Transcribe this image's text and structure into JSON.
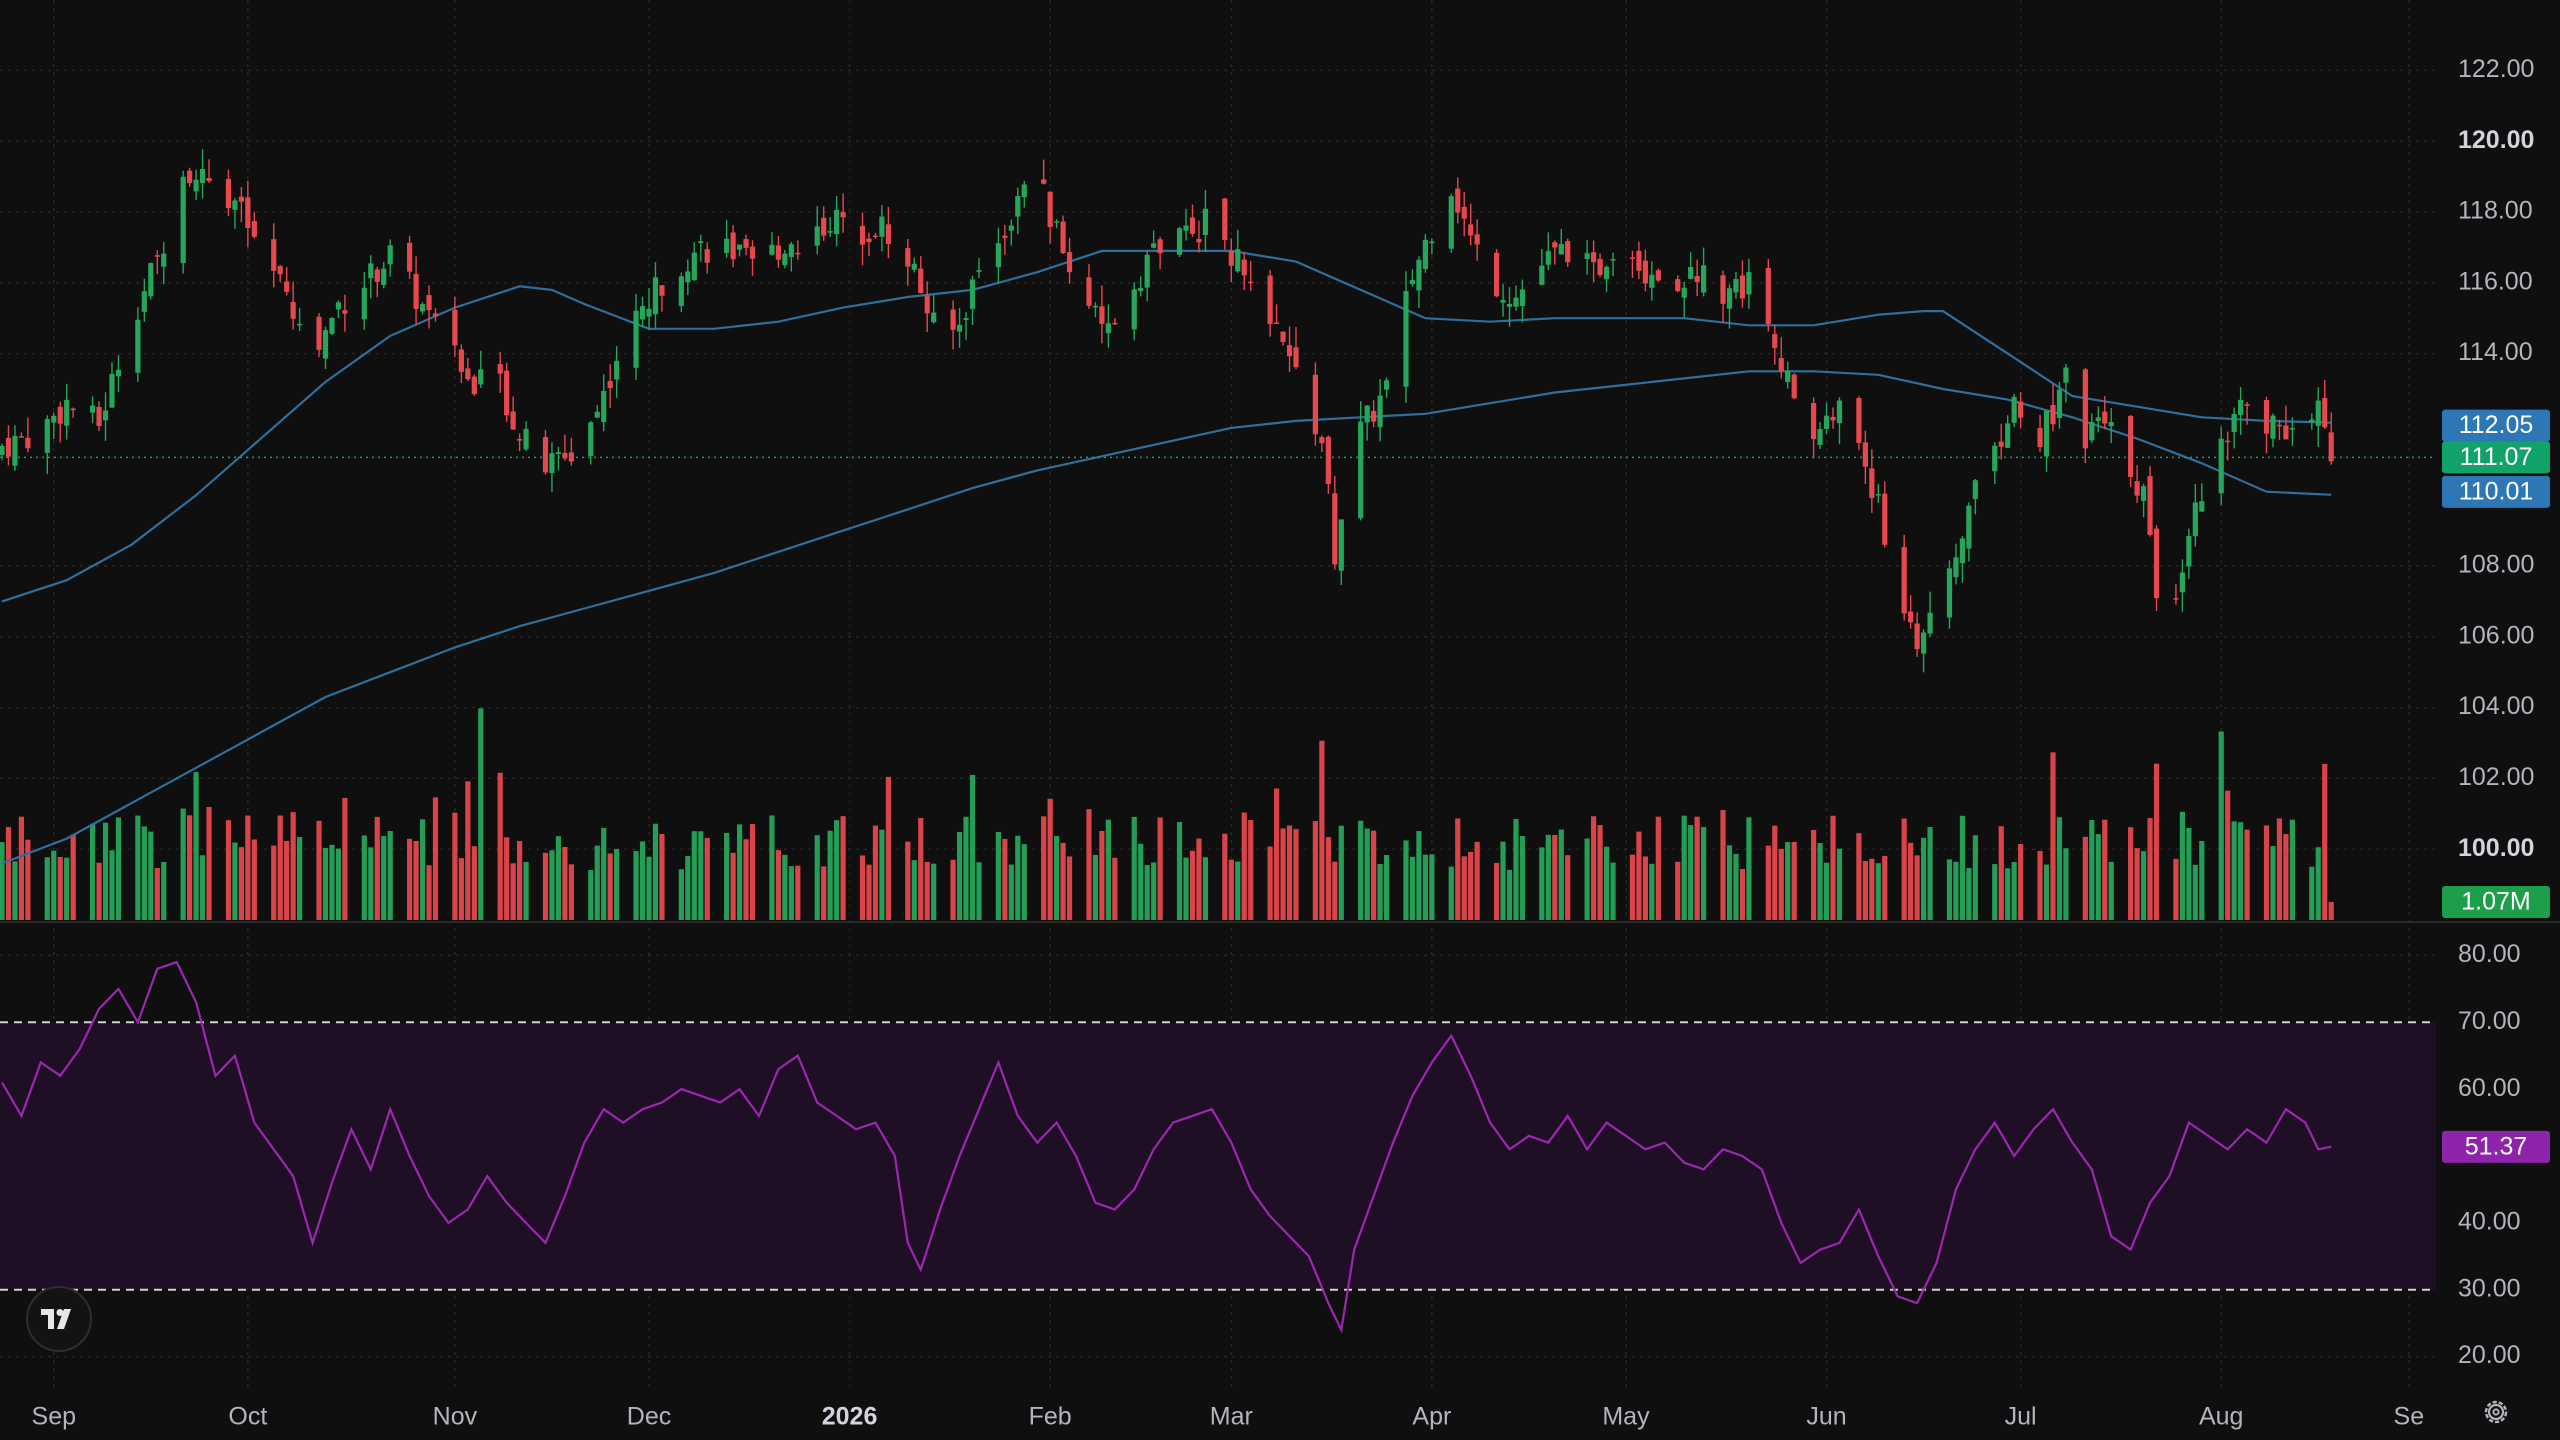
{
  "chart_data": {
    "type": "candlestick",
    "colors": {
      "background": "#0f0f0f",
      "grid": "#262626",
      "up": "#26a65b",
      "down": "#e5484d",
      "ma": "#2f6f9e",
      "rsi_line": "#9c27b0",
      "rsi_band": "#1e0f24",
      "axis_text": "#b2b5be",
      "badge_ma_fast": "#2d77b5",
      "badge_last": "#12a36a",
      "badge_volume": "#1d9e4a",
      "badge_rsi": "#8e24aa"
    },
    "price_axis": {
      "ylim": [
        98,
        123
      ],
      "ticks": [
        "122.00",
        "120.00",
        "118.00",
        "116.00",
        "114.00",
        "104.00",
        "102.00",
        "100.00"
      ],
      "bold_ticks": [
        "120.00",
        "100.00"
      ]
    },
    "rsi_axis": {
      "ylim": [
        15,
        85
      ],
      "ticks": [
        "80.00",
        "70.00",
        "60.00",
        "40.00",
        "30.00",
        "20.00"
      ],
      "upper_band": 70,
      "lower_band": 30
    },
    "time_axis": {
      "labels": [
        "Sep",
        "Oct",
        "Nov",
        "Dec",
        "2026",
        "Feb",
        "Mar",
        "Apr",
        "May",
        "Jun",
        "Jul",
        "Aug",
        "Se"
      ],
      "label_days": [
        8,
        38,
        70,
        100,
        131,
        162,
        190,
        221,
        251,
        282,
        312,
        343,
        372
      ],
      "bold_labels": [
        "2026"
      ]
    },
    "price_anchors": [
      [
        0,
        111.4
      ],
      [
        6,
        111.8
      ],
      [
        10,
        112.6
      ],
      [
        15,
        112.0
      ],
      [
        20,
        115.0
      ],
      [
        24,
        116.6
      ],
      [
        28,
        119.0
      ],
      [
        33,
        119.0
      ],
      [
        36,
        118.3
      ],
      [
        40,
        116.8
      ],
      [
        44,
        115.6
      ],
      [
        48,
        113.8
      ],
      [
        52,
        115.4
      ],
      [
        56,
        116.0
      ],
      [
        60,
        116.8
      ],
      [
        64,
        115.6
      ],
      [
        68,
        114.4
      ],
      [
        72,
        113.2
      ],
      [
        76,
        113.6
      ],
      [
        80,
        111.7
      ],
      [
        84,
        110.8
      ],
      [
        88,
        111.2
      ],
      [
        92,
        112.4
      ],
      [
        96,
        114.4
      ],
      [
        100,
        115.5
      ],
      [
        104,
        116.5
      ],
      [
        108,
        117.0
      ],
      [
        112,
        117.0
      ],
      [
        116,
        116.4
      ],
      [
        120,
        117.0
      ],
      [
        124,
        117.2
      ],
      [
        128,
        117.8
      ],
      [
        132,
        117.5
      ],
      [
        136,
        117.6
      ],
      [
        140,
        116.8
      ],
      [
        142,
        115.8
      ],
      [
        145,
        114.2
      ],
      [
        148,
        114.8
      ],
      [
        151,
        116.5
      ],
      [
        154,
        117.3
      ],
      [
        157,
        118.2
      ],
      [
        159,
        119.8
      ],
      [
        161,
        118.4
      ],
      [
        164,
        116.8
      ],
      [
        167,
        116.0
      ],
      [
        170,
        114.4
      ],
      [
        174,
        115.6
      ],
      [
        178,
        117.0
      ],
      [
        182,
        117.2
      ],
      [
        186,
        117.7
      ],
      [
        189,
        117.2
      ],
      [
        192,
        116.2
      ],
      [
        196,
        114.8
      ],
      [
        200,
        113.4
      ],
      [
        204,
        111.5
      ],
      [
        206,
        108.4
      ],
      [
        208,
        110.6
      ],
      [
        210,
        111.8
      ],
      [
        214,
        113.0
      ],
      [
        218,
        116.2
      ],
      [
        221,
        117.6
      ],
      [
        224,
        118.8
      ],
      [
        227,
        117.2
      ],
      [
        231,
        116.0
      ],
      [
        234,
        115.6
      ],
      [
        238,
        116.5
      ],
      [
        242,
        117.0
      ],
      [
        246,
        116.2
      ],
      [
        250,
        117.4
      ],
      [
        254,
        116.4
      ],
      [
        258,
        116.0
      ],
      [
        262,
        116.3
      ],
      [
        266,
        115.8
      ],
      [
        270,
        116.0
      ],
      [
        274,
        114.6
      ],
      [
        277,
        112.4
      ],
      [
        280,
        111.8
      ],
      [
        284,
        112.4
      ],
      [
        287,
        111.6
      ],
      [
        290,
        109.6
      ],
      [
        293,
        107.2
      ],
      [
        296,
        106.0
      ],
      [
        299,
        106.4
      ],
      [
        302,
        108.2
      ],
      [
        305,
        110.4
      ],
      [
        308,
        111.3
      ],
      [
        311,
        112.5
      ],
      [
        314,
        111.2
      ],
      [
        317,
        112.4
      ],
      [
        319,
        113.6
      ],
      [
        322,
        111.6
      ],
      [
        325,
        112.0
      ],
      [
        328,
        111.2
      ],
      [
        331,
        110.0
      ],
      [
        334,
        106.0
      ],
      [
        337,
        108.2
      ],
      [
        340,
        110.2
      ],
      [
        343,
        111.4
      ],
      [
        346,
        112.5
      ],
      [
        349,
        111.6
      ],
      [
        352,
        112.2
      ],
      [
        355,
        111.4
      ],
      [
        358,
        112.5
      ],
      [
        360,
        111.07
      ]
    ],
    "last_day": 360,
    "moving_averages": [
      {
        "period": 50,
        "points": [
          [
            0,
            107.0
          ],
          [
            10,
            107.6
          ],
          [
            20,
            108.6
          ],
          [
            30,
            110.0
          ],
          [
            40,
            111.6
          ],
          [
            50,
            113.2
          ],
          [
            60,
            114.5
          ],
          [
            70,
            115.3
          ],
          [
            80,
            115.9
          ],
          [
            85,
            115.8
          ],
          [
            90,
            115.4
          ],
          [
            100,
            114.7
          ],
          [
            110,
            114.7
          ],
          [
            120,
            114.9
          ],
          [
            130,
            115.3
          ],
          [
            140,
            115.6
          ],
          [
            150,
            115.8
          ],
          [
            160,
            116.3
          ],
          [
            170,
            116.9
          ],
          [
            180,
            116.9
          ],
          [
            190,
            116.9
          ],
          [
            200,
            116.6
          ],
          [
            210,
            115.8
          ],
          [
            220,
            115.0
          ],
          [
            230,
            114.9
          ],
          [
            240,
            115.0
          ],
          [
            250,
            115.0
          ],
          [
            260,
            115.0
          ],
          [
            270,
            114.8
          ],
          [
            280,
            114.8
          ],
          [
            290,
            115.1
          ],
          [
            297,
            115.2
          ],
          [
            300,
            115.2
          ],
          [
            310,
            114.0
          ],
          [
            320,
            112.8
          ],
          [
            330,
            112.5
          ],
          [
            340,
            112.2
          ],
          [
            350,
            112.1
          ],
          [
            360,
            112.05
          ]
        ]
      },
      {
        "period": 200,
        "points": [
          [
            0,
            99.6
          ],
          [
            10,
            100.3
          ],
          [
            20,
            101.3
          ],
          [
            30,
            102.3
          ],
          [
            40,
            103.3
          ],
          [
            50,
            104.3
          ],
          [
            60,
            105.0
          ],
          [
            70,
            105.7
          ],
          [
            80,
            106.3
          ],
          [
            90,
            106.8
          ],
          [
            100,
            107.3
          ],
          [
            110,
            107.8
          ],
          [
            120,
            108.4
          ],
          [
            130,
            109.0
          ],
          [
            140,
            109.6
          ],
          [
            150,
            110.2
          ],
          [
            160,
            110.7
          ],
          [
            170,
            111.1
          ],
          [
            180,
            111.5
          ],
          [
            190,
            111.9
          ],
          [
            200,
            112.1
          ],
          [
            210,
            112.2
          ],
          [
            220,
            112.3
          ],
          [
            230,
            112.6
          ],
          [
            240,
            112.9
          ],
          [
            250,
            113.1
          ],
          [
            260,
            113.3
          ],
          [
            270,
            113.5
          ],
          [
            280,
            113.5
          ],
          [
            290,
            113.4
          ],
          [
            300,
            113.0
          ],
          [
            310,
            112.7
          ],
          [
            320,
            112.2
          ],
          [
            330,
            111.6
          ],
          [
            340,
            110.9
          ],
          [
            350,
            110.1
          ],
          [
            360,
            110.01
          ]
        ]
      }
    ],
    "rsi": {
      "period": 14,
      "anchors": [
        [
          0,
          61
        ],
        [
          3,
          56
        ],
        [
          6,
          64
        ],
        [
          9,
          62
        ],
        [
          12,
          66
        ],
        [
          15,
          72
        ],
        [
          18,
          75
        ],
        [
          21,
          70
        ],
        [
          24,
          78
        ],
        [
          27,
          79
        ],
        [
          30,
          73
        ],
        [
          33,
          62
        ],
        [
          36,
          65
        ],
        [
          39,
          55
        ],
        [
          42,
          51
        ],
        [
          45,
          47
        ],
        [
          48,
          37
        ],
        [
          51,
          46
        ],
        [
          54,
          54
        ],
        [
          57,
          48
        ],
        [
          60,
          57
        ],
        [
          63,
          50
        ],
        [
          66,
          44
        ],
        [
          69,
          40
        ],
        [
          72,
          42
        ],
        [
          75,
          47
        ],
        [
          78,
          43
        ],
        [
          81,
          40
        ],
        [
          84,
          37
        ],
        [
          87,
          44
        ],
        [
          90,
          52
        ],
        [
          93,
          57
        ],
        [
          96,
          55
        ],
        [
          99,
          57
        ],
        [
          102,
          58
        ],
        [
          105,
          60
        ],
        [
          108,
          59
        ],
        [
          111,
          58
        ],
        [
          114,
          60
        ],
        [
          117,
          56
        ],
        [
          120,
          63
        ],
        [
          123,
          65
        ],
        [
          126,
          58
        ],
        [
          129,
          56
        ],
        [
          132,
          54
        ],
        [
          135,
          55
        ],
        [
          138,
          50
        ],
        [
          140,
          37
        ],
        [
          142,
          33
        ],
        [
          145,
          42
        ],
        [
          148,
          50
        ],
        [
          151,
          57
        ],
        [
          154,
          64
        ],
        [
          157,
          56
        ],
        [
          160,
          52
        ],
        [
          163,
          55
        ],
        [
          166,
          50
        ],
        [
          169,
          43
        ],
        [
          172,
          42
        ],
        [
          175,
          45
        ],
        [
          178,
          51
        ],
        [
          181,
          55
        ],
        [
          184,
          56
        ],
        [
          187,
          57
        ],
        [
          190,
          52
        ],
        [
          193,
          45
        ],
        [
          196,
          41
        ],
        [
          199,
          38
        ],
        [
          202,
          35
        ],
        [
          205,
          28
        ],
        [
          207,
          24
        ],
        [
          209,
          36
        ],
        [
          212,
          44
        ],
        [
          215,
          52
        ],
        [
          218,
          59
        ],
        [
          221,
          64
        ],
        [
          224,
          68
        ],
        [
          227,
          62
        ],
        [
          230,
          55
        ],
        [
          233,
          51
        ],
        [
          236,
          53
        ],
        [
          239,
          52
        ],
        [
          242,
          56
        ],
        [
          245,
          51
        ],
        [
          248,
          55
        ],
        [
          251,
          53
        ],
        [
          254,
          51
        ],
        [
          257,
          52
        ],
        [
          260,
          49
        ],
        [
          263,
          48
        ],
        [
          266,
          51
        ],
        [
          269,
          50
        ],
        [
          272,
          48
        ],
        [
          275,
          40
        ],
        [
          278,
          34
        ],
        [
          281,
          36
        ],
        [
          284,
          37
        ],
        [
          287,
          42
        ],
        [
          290,
          35
        ],
        [
          293,
          29
        ],
        [
          296,
          28
        ],
        [
          299,
          34
        ],
        [
          302,
          45
        ],
        [
          305,
          51
        ],
        [
          308,
          55
        ],
        [
          311,
          50
        ],
        [
          314,
          54
        ],
        [
          317,
          57
        ],
        [
          320,
          52
        ],
        [
          323,
          48
        ],
        [
          326,
          38
        ],
        [
          329,
          36
        ],
        [
          332,
          43
        ],
        [
          335,
          47
        ],
        [
          338,
          55
        ],
        [
          341,
          53
        ],
        [
          344,
          51
        ],
        [
          347,
          54
        ],
        [
          350,
          52
        ],
        [
          353,
          57
        ],
        [
          356,
          55
        ],
        [
          358,
          51
        ],
        [
          360,
          51.37
        ]
      ]
    },
    "last_values": {
      "ma_fast": "112.05",
      "last_price": "111.07",
      "ma_slow": "110.01",
      "volume": "1.07M",
      "rsi": "51.37"
    }
  },
  "logo_icon": "tradingview-logo-icon",
  "settings_icon": "gear-icon"
}
